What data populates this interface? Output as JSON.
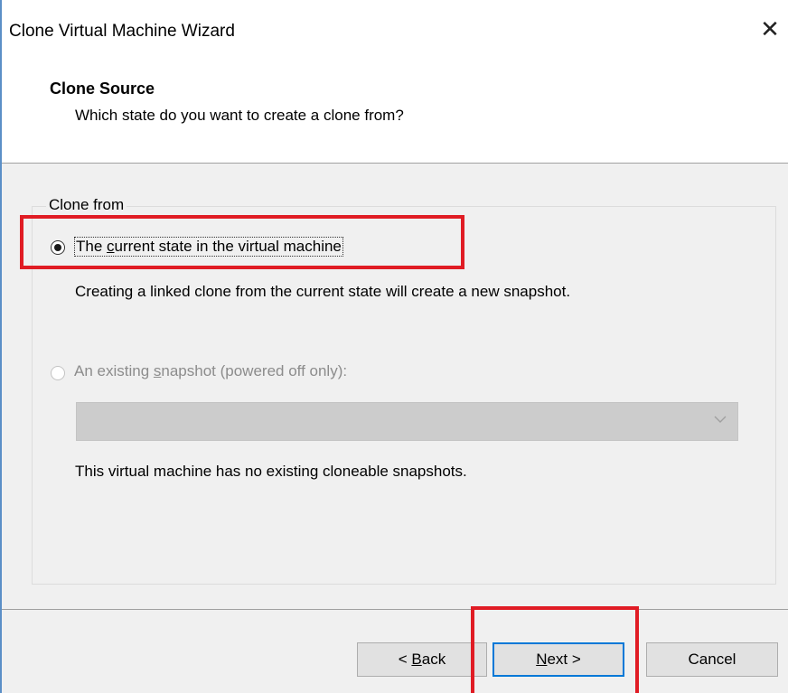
{
  "window": {
    "title": "Clone Virtual Machine Wizard",
    "close_glyph": "✕"
  },
  "header": {
    "title": "Clone Source",
    "subtitle": "Which state do you want to create a clone from?"
  },
  "group": {
    "label": "Clone from",
    "option_current": {
      "pre": "The ",
      "mnemonic": "c",
      "post": "urrent state in the virtual machine",
      "selected": true
    },
    "option_current_desc": "Creating a linked clone from the current state will create a new snapshot.",
    "option_snapshot": {
      "pre": "An existing ",
      "mnemonic": "s",
      "post": "napshot (powered off only):",
      "selected": false,
      "enabled": false
    },
    "snapshot_select": {
      "value": "",
      "enabled": false
    },
    "snapshot_desc": "This virtual machine has no existing cloneable snapshots."
  },
  "buttons": {
    "back": {
      "pre": "< ",
      "mnemonic": "B",
      "post": "ack"
    },
    "next": {
      "pre": "",
      "mnemonic": "N",
      "post": "ext >"
    },
    "cancel": {
      "label": "Cancel"
    }
  },
  "colors": {
    "highlight": "#e01c24",
    "focus": "#0078d7",
    "window_border": "#5b8fc7"
  }
}
